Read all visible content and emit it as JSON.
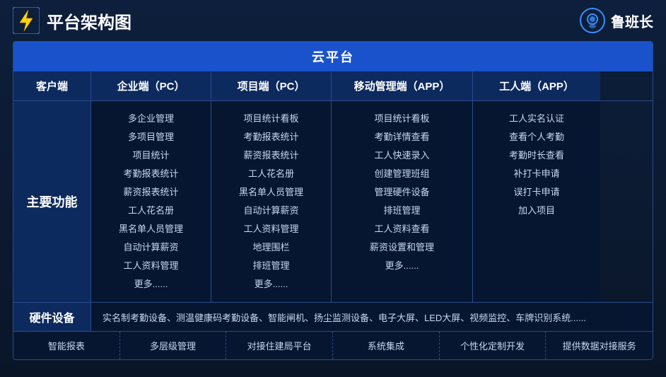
{
  "header": {
    "title": "平台架构图",
    "brand": "鲁班长"
  },
  "cloud": {
    "label": "云平台"
  },
  "columns": {
    "headers": [
      "客户端",
      "企业端（PC）",
      "项目端（PC）",
      "移动管理端（APP）",
      "工人端（APP）"
    ]
  },
  "row_label": "主要功能",
  "enterprise_items": [
    "多企业管理",
    "多项目管理",
    "项目统计",
    "考勤报表统计",
    "薪资报表统计",
    "工人花名册",
    "黑名单人员管理",
    "自动计算薪资",
    "工人资料管理",
    "更多......"
  ],
  "project_items": [
    "项目统计看板",
    "考勤报表统计",
    "薪资报表统计",
    "工人花名册",
    "黑名单人员管理",
    "自动计算薪资",
    "工人资料管理",
    "地理围栏",
    "排班管理",
    "更多......"
  ],
  "mobile_items": [
    "项目统计看板",
    "考勤详情查看",
    "工人快速录入",
    "创建管理班组",
    "管理硬件设备",
    "排班管理",
    "工人资料查看",
    "薪资设置和管理",
    "更多......"
  ],
  "worker_items": [
    "工人实名认证",
    "查看个人考勤",
    "考勤时长查看",
    "补打卡申请",
    "误打卡申请",
    "加入项目"
  ],
  "hardware": {
    "label": "硬件设备",
    "content": "实名制考勤设备、测温健康码考勤设备、智能闸机、扬尘监测设备、电子大屏、LED大屏、视频监控、车牌识别系统......"
  },
  "features": [
    "智能报表",
    "多层级管理",
    "对接住建局平台",
    "系统集成",
    "个性化定制开发",
    "提供数据对接服务"
  ]
}
